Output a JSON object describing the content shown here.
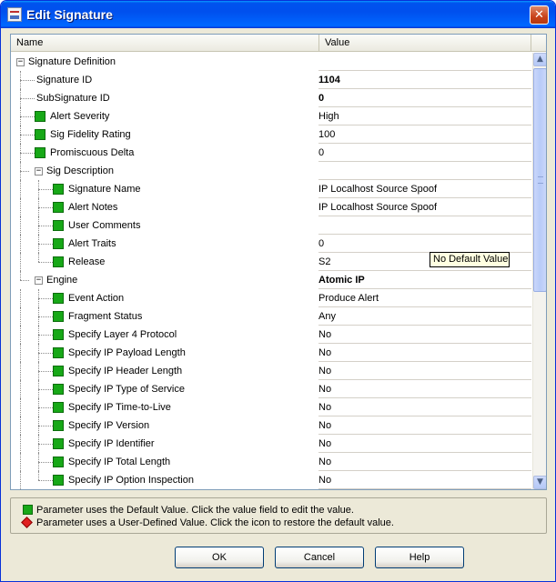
{
  "window": {
    "title": "Edit Signature",
    "close_glyph": "✕",
    "icon": "signature-app-icon"
  },
  "grid": {
    "columns": [
      "Name",
      "Value"
    ],
    "rows": [
      {
        "label": "Signature Definition",
        "value": "",
        "level": 0,
        "type": "group",
        "bold": false
      },
      {
        "label": "Signature ID",
        "value": "1104",
        "level": 1,
        "type": "plain",
        "bold": true
      },
      {
        "label": "SubSignature ID",
        "value": "0",
        "level": 1,
        "type": "plain",
        "bold": true
      },
      {
        "label": "Alert Severity",
        "value": "High",
        "level": 1,
        "type": "default",
        "bold": false
      },
      {
        "label": "Sig Fidelity Rating",
        "value": "100",
        "level": 1,
        "type": "default",
        "bold": false
      },
      {
        "label": "Promiscuous Delta",
        "value": "0",
        "level": 1,
        "type": "default",
        "bold": false
      },
      {
        "label": "Sig Description",
        "value": "",
        "level": 1,
        "type": "group",
        "bold": false
      },
      {
        "label": "Signature Name",
        "value": "IP Localhost Source Spoof",
        "level": 2,
        "type": "default",
        "bold": false
      },
      {
        "label": "Alert Notes",
        "value": "IP Localhost Source Spoof",
        "level": 2,
        "type": "default",
        "bold": false
      },
      {
        "label": "User Comments",
        "value": "",
        "level": 2,
        "type": "default",
        "bold": false
      },
      {
        "label": "Alert Traits",
        "value": "0",
        "level": 2,
        "type": "default",
        "bold": false
      },
      {
        "label": "Release",
        "value": "S2",
        "level": 2,
        "type": "default",
        "bold": false
      },
      {
        "label": "Engine",
        "value": "Atomic IP",
        "level": 1,
        "type": "group",
        "bold": true
      },
      {
        "label": "Event Action",
        "value": "Produce Alert",
        "level": 2,
        "type": "default",
        "bold": false
      },
      {
        "label": "Fragment Status",
        "value": "Any",
        "level": 2,
        "type": "default",
        "bold": false
      },
      {
        "label": "Specify Layer 4 Protocol",
        "value": "No",
        "level": 2,
        "type": "default",
        "bold": false
      },
      {
        "label": "Specify IP Payload Length",
        "value": "No",
        "level": 2,
        "type": "default",
        "bold": false
      },
      {
        "label": "Specify IP Header Length",
        "value": "No",
        "level": 2,
        "type": "default",
        "bold": false
      },
      {
        "label": "Specify IP Type of Service",
        "value": "No",
        "level": 2,
        "type": "default",
        "bold": false
      },
      {
        "label": "Specify IP Time-to-Live",
        "value": "No",
        "level": 2,
        "type": "default",
        "bold": false
      },
      {
        "label": "Specify IP Version",
        "value": "No",
        "level": 2,
        "type": "default",
        "bold": false
      },
      {
        "label": "Specify IP Identifier",
        "value": "No",
        "level": 2,
        "type": "default",
        "bold": false
      },
      {
        "label": "Specify IP Total Length",
        "value": "No",
        "level": 2,
        "type": "default",
        "bold": false
      },
      {
        "label": "Specify IP Option Inspection",
        "value": "No",
        "level": 2,
        "type": "default",
        "bold": false
      }
    ],
    "tooltip": "No Default Value",
    "scroll_up_glyph": "▲",
    "scroll_down_glyph": "▼"
  },
  "legend": {
    "default_text": "Parameter uses the Default Value.  Click the value field to edit the value.",
    "user_text": "Parameter uses a User-Defined Value.  Click the icon to restore the default value.",
    "default_color": "#17a817",
    "user_color": "#e02020"
  },
  "buttons": {
    "ok": "OK",
    "cancel": "Cancel",
    "help": "Help"
  },
  "colors": {
    "titlebar": "#0054e3",
    "dialog_bg": "#ece9d8",
    "default_icon": "#17a817"
  }
}
